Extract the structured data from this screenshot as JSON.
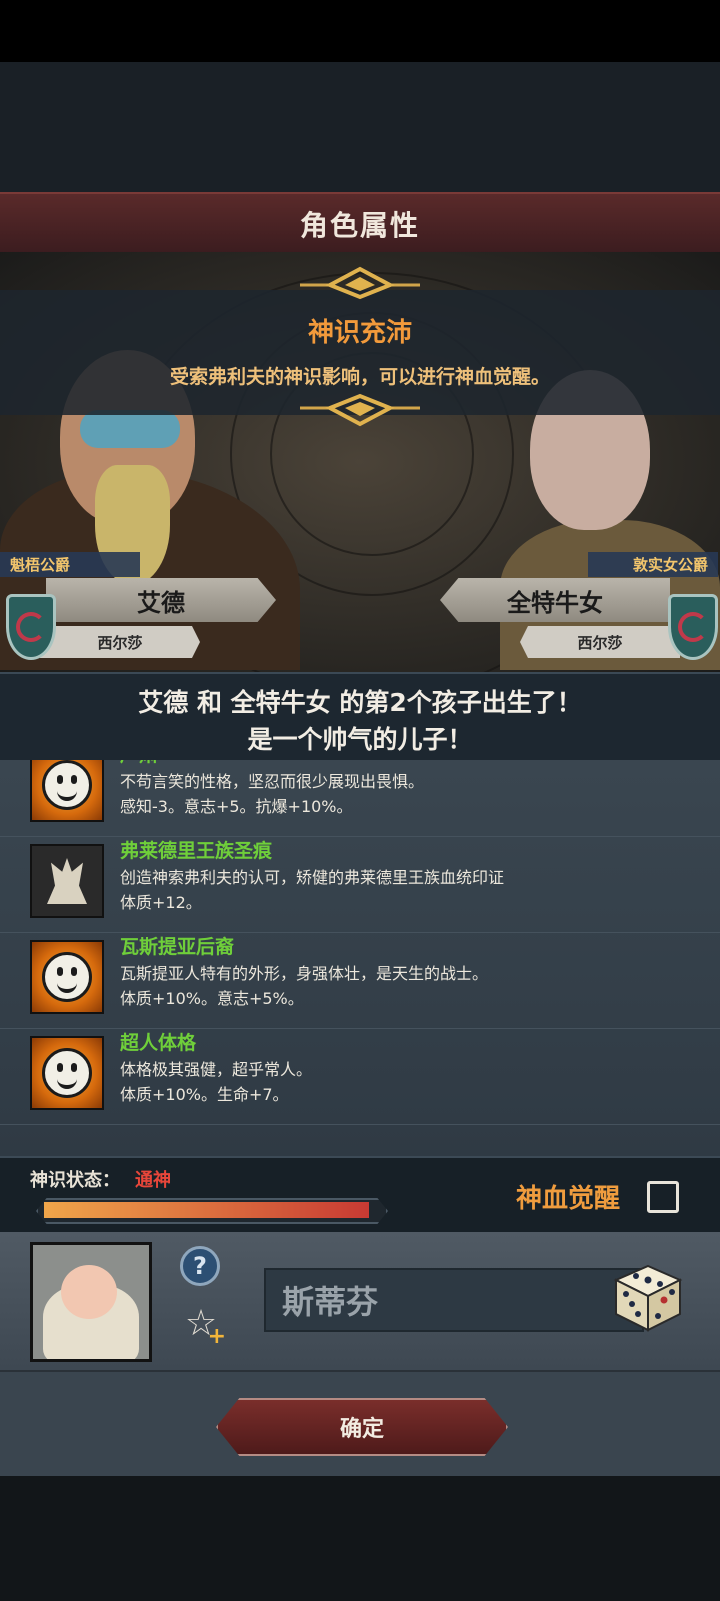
{
  "header": {
    "title": "角色属性"
  },
  "event": {
    "title": "神识充沛",
    "description": "受索弗利夫的神识影响，可以进行神血觉醒。"
  },
  "father": {
    "title": "魁梧公爵",
    "name": "艾德",
    "region": "西尔莎"
  },
  "mother": {
    "title": "敦实女公爵",
    "name": "全特牛女",
    "region": "西尔莎"
  },
  "birth_message": {
    "line1": "艾德 和 全特牛女 的第2个孩子出生了！",
    "line2": "是一个帅气的儿子！"
  },
  "traits": [
    {
      "name": "严肃",
      "icon": "smiley-face-icon",
      "description": "不苟言笑的性格，坚忍而很少展现出畏惧。",
      "effect": "感知-3。意志+5。抗爆+10%。"
    },
    {
      "name": "弗莱德里王族圣痕",
      "icon": "royal-stigma-icon",
      "description": "创造神索弗利夫的认可，矫健的弗莱德里王族血统印证",
      "effect": "体质+12。"
    },
    {
      "name": "瓦斯提亚后裔",
      "icon": "smiley-face-icon",
      "description": "瓦斯提亚人特有的外形，身强体壮，是天生的战士。",
      "effect": "体质+10%。意志+5%。"
    },
    {
      "name": "超人体格",
      "icon": "smiley-face-icon",
      "description": "体格极其强健，超乎常人。",
      "effect": "体质+10%。生命+7。"
    }
  ],
  "divine_status": {
    "label": "神识状态：",
    "value": "通神",
    "progress": 0.98,
    "awaken_label": "神血觉醒",
    "awaken_checked": false
  },
  "child": {
    "name": "斯蒂芬",
    "help_icon": "?",
    "favorite_icon": "star-plus-icon",
    "dice_icon": "dice-icon"
  },
  "footer": {
    "confirm_label": "确定"
  },
  "colors": {
    "accent_orange": "#f29a3b",
    "trait_green": "#6fcf3a",
    "status_red": "#e8463a",
    "banner_red": "#5a2a2a"
  }
}
